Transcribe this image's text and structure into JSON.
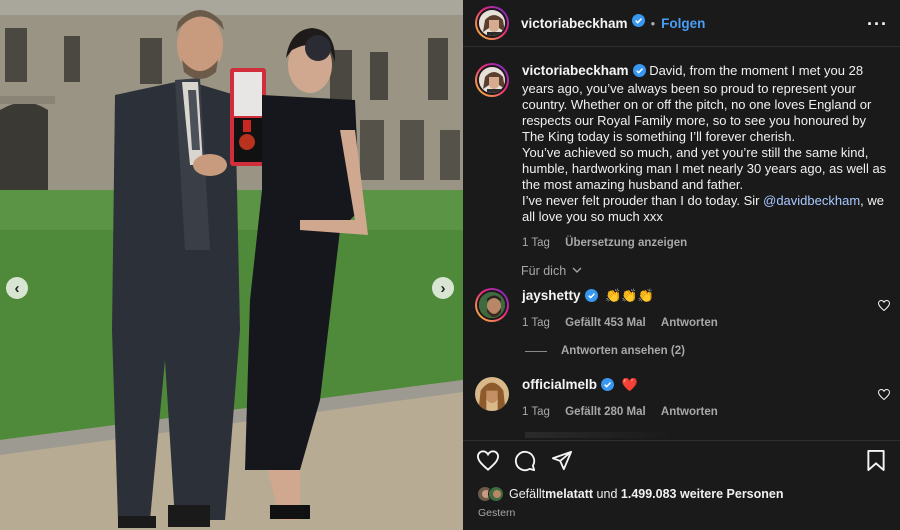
{
  "post": {
    "author": "victoriabeckham",
    "follow_label": "Folgen",
    "more_icon": "more-horizontal-icon"
  },
  "caption": {
    "username": "victoriabeckham",
    "text_1": "David, from the moment I met you 28 years ago, you’ve always been so proud to represent your country. Whether on or off the pitch, no one loves England or respects our Royal Family more, so to see you honoured by The King today is something I’ll forever cherish.",
    "text_2": "You’ve achieved so much, and yet you’re still the same kind, humble, hardworking man I met nearly 30 years ago, as well as the most amazing husband and father.",
    "text_3": "I’ve never felt prouder than I do today. Sir ",
    "mention": "@davidbeckham",
    "text_4": ", we all love you so much xxx",
    "time": "1 Tag",
    "translate": "Übersetzung anzeigen"
  },
  "fuer_dich": "Für dich",
  "comments": [
    {
      "username": "jayshetty",
      "text": "👏👏👏",
      "time": "1 Tag",
      "likes": "Gefällt 453 Mal",
      "reply": "Antworten"
    },
    {
      "username": "officialmelb",
      "text": "❤️",
      "time": "1 Tag",
      "likes": "Gefällt 280 Mal",
      "reply": "Antworten"
    }
  ],
  "view_replies": "Antworten ansehen (2)",
  "likes_summary": {
    "prefix": "Gefällt ",
    "user": "melatatt",
    "middle": " und ",
    "count": "1.499.083 weitere Personen"
  },
  "date": "Gestern",
  "colors": {
    "panel_bg": "#1a1a1a",
    "link_blue": "#4a9ef4",
    "verified_blue": "#3897f0",
    "secondary_text": "#a8a8a8"
  }
}
